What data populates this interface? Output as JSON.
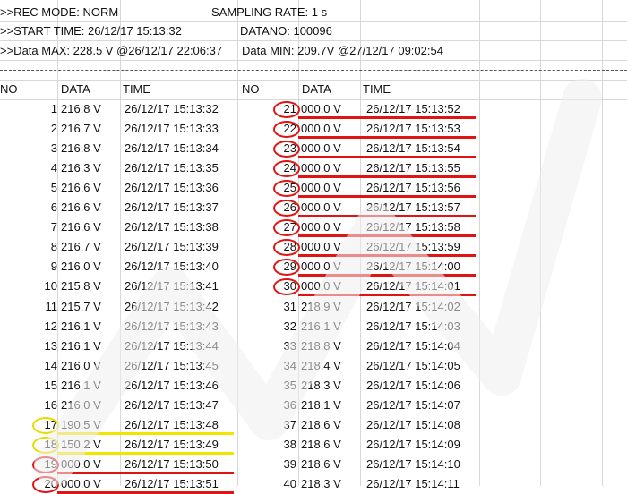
{
  "header": {
    "rec_mode": ">>REC MODE: NORM",
    "sampling_rate": "SAMPLING RATE: 1 s",
    "start_time": ">>START TIME: 26/12/17 15:13:32",
    "datano": "DATANO: 100096",
    "data_max": ">>Data MAX: 228.5 V @26/12/17 22:06:37",
    "data_min": "Data MIN: 209.7V @27/12/17 09:02:54"
  },
  "columns": {
    "no": "NO",
    "data": "DATA",
    "time": "TIME"
  },
  "left_rows": [
    {
      "no": "1",
      "data": "216.8 V",
      "time": "26/12/17 15:13:32",
      "mark": "none"
    },
    {
      "no": "2",
      "data": "216.7 V",
      "time": "26/12/17 15:13:33",
      "mark": "none"
    },
    {
      "no": "3",
      "data": "216.8 V",
      "time": "26/12/17 15:13:34",
      "mark": "none"
    },
    {
      "no": "4",
      "data": "216.3 V",
      "time": "26/12/17 15:13:35",
      "mark": "none"
    },
    {
      "no": "5",
      "data": "216.6 V",
      "time": "26/12/17 15:13:36",
      "mark": "none"
    },
    {
      "no": "6",
      "data": "216.6 V",
      "time": "26/12/17 15:13:37",
      "mark": "none"
    },
    {
      "no": "7",
      "data": "216.6 V",
      "time": "26/12/17 15:13:38",
      "mark": "none"
    },
    {
      "no": "8",
      "data": "216.7 V",
      "time": "26/12/17 15:13:39",
      "mark": "none"
    },
    {
      "no": "9",
      "data": "216.0 V",
      "time": "26/12/17 15:13:40",
      "mark": "none"
    },
    {
      "no": "10",
      "data": "215.8 V",
      "time": "26/12/17 15:13:41",
      "mark": "none"
    },
    {
      "no": "11",
      "data": "215.7 V",
      "time": "26/12/17 15:13:42",
      "mark": "none"
    },
    {
      "no": "12",
      "data": "216.1 V",
      "time": "26/12/17 15:13:43",
      "mark": "none"
    },
    {
      "no": "13",
      "data": "216.1 V",
      "time": "26/12/17 15:13:44",
      "mark": "none"
    },
    {
      "no": "14",
      "data": "216.0 V",
      "time": "26/12/17 15:13:45",
      "mark": "none"
    },
    {
      "no": "15",
      "data": "216.1 V",
      "time": "26/12/17 15:13:46",
      "mark": "none"
    },
    {
      "no": "16",
      "data": "216.0 V",
      "time": "26/12/17 15:13:47",
      "mark": "none"
    },
    {
      "no": "17",
      "data": "190.5 V",
      "time": "26/12/17 15:13:48",
      "mark": "yellow"
    },
    {
      "no": "18",
      "data": "150.2 V",
      "time": "26/12/17 15:13:49",
      "mark": "yellow"
    },
    {
      "no": "19",
      "data": "000.0 V",
      "time": "26/12/17 15:13:50",
      "mark": "red"
    },
    {
      "no": "20",
      "data": "000.0 V",
      "time": "26/12/17 15:13:51",
      "mark": "red"
    }
  ],
  "right_rows": [
    {
      "no": "21",
      "data": "000.0 V",
      "time": "26/12/17 15:13:52",
      "mark": "red"
    },
    {
      "no": "22",
      "data": "000.0 V",
      "time": "26/12/17 15:13:53",
      "mark": "red"
    },
    {
      "no": "23",
      "data": "000.0 V",
      "time": "26/12/17 15:13:54",
      "mark": "red"
    },
    {
      "no": "24",
      "data": "000.0 V",
      "time": "26/12/17 15:13:55",
      "mark": "red"
    },
    {
      "no": "25",
      "data": "000.0 V",
      "time": "26/12/17 15:13:56",
      "mark": "red"
    },
    {
      "no": "26",
      "data": "000.0 V",
      "time": "26/12/17 15:13:57",
      "mark": "red"
    },
    {
      "no": "27",
      "data": "000.0 V",
      "time": "26/12/17 15:13:58",
      "mark": "red"
    },
    {
      "no": "28",
      "data": "000.0 V",
      "time": "26/12/17 15:13:59",
      "mark": "red"
    },
    {
      "no": "29",
      "data": "000.0 V",
      "time": "26/12/17 15:14:00",
      "mark": "red"
    },
    {
      "no": "30",
      "data": "000.0 V",
      "time": "26/12/17 15:14:01",
      "mark": "red"
    },
    {
      "no": "31",
      "data": "218.9 V",
      "time": "26/12/17 15:14:02",
      "mark": "none"
    },
    {
      "no": "32",
      "data": "216.1 V",
      "time": "26/12/17 15:14:03",
      "mark": "none"
    },
    {
      "no": "33",
      "data": "218.8 V",
      "time": "26/12/17 15:14:04",
      "mark": "none"
    },
    {
      "no": "34",
      "data": "218.4 V",
      "time": "26/12/17 15:14:05",
      "mark": "none"
    },
    {
      "no": "35",
      "data": "218.3 V",
      "time": "26/12/17 15:14:06",
      "mark": "none"
    },
    {
      "no": "36",
      "data": "218.1 V",
      "time": "26/12/17 15:14:07",
      "mark": "none"
    },
    {
      "no": "37",
      "data": "218.6 V",
      "time": "26/12/17 15:14:08",
      "mark": "none"
    },
    {
      "no": "38",
      "data": "218.6 V",
      "time": "26/12/17 15:14:09",
      "mark": "none"
    },
    {
      "no": "39",
      "data": "218.6 V",
      "time": "26/12/17 15:14:10",
      "mark": "none"
    },
    {
      "no": "40",
      "data": "218.3 V",
      "time": "26/12/17 15:14:11",
      "mark": "none"
    }
  ],
  "colors": {
    "red_mark": "#e11414",
    "yellow_mark": "#f2e600",
    "grid": "#d8d8d8"
  }
}
